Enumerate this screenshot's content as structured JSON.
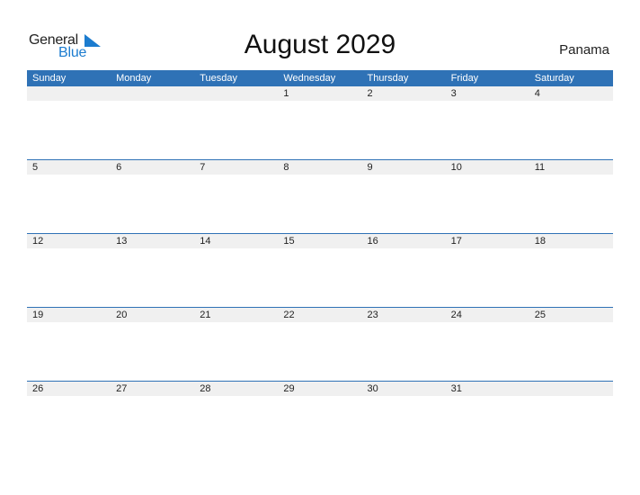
{
  "logo": {
    "word1": "General",
    "word2": "Blue"
  },
  "title": "August 2029",
  "country": "Panama",
  "colors": {
    "header_bg": "#2f72b6",
    "row_bg": "#f0f0f0",
    "logo_blue": "#1c7ccf"
  },
  "weekdays": [
    "Sunday",
    "Monday",
    "Tuesday",
    "Wednesday",
    "Thursday",
    "Friday",
    "Saturday"
  ],
  "weeks": [
    [
      "",
      "",
      "",
      "1",
      "2",
      "3",
      "4"
    ],
    [
      "5",
      "6",
      "7",
      "8",
      "9",
      "10",
      "11"
    ],
    [
      "12",
      "13",
      "14",
      "15",
      "16",
      "17",
      "18"
    ],
    [
      "19",
      "20",
      "21",
      "22",
      "23",
      "24",
      "25"
    ],
    [
      "26",
      "27",
      "28",
      "29",
      "30",
      "31",
      ""
    ]
  ]
}
